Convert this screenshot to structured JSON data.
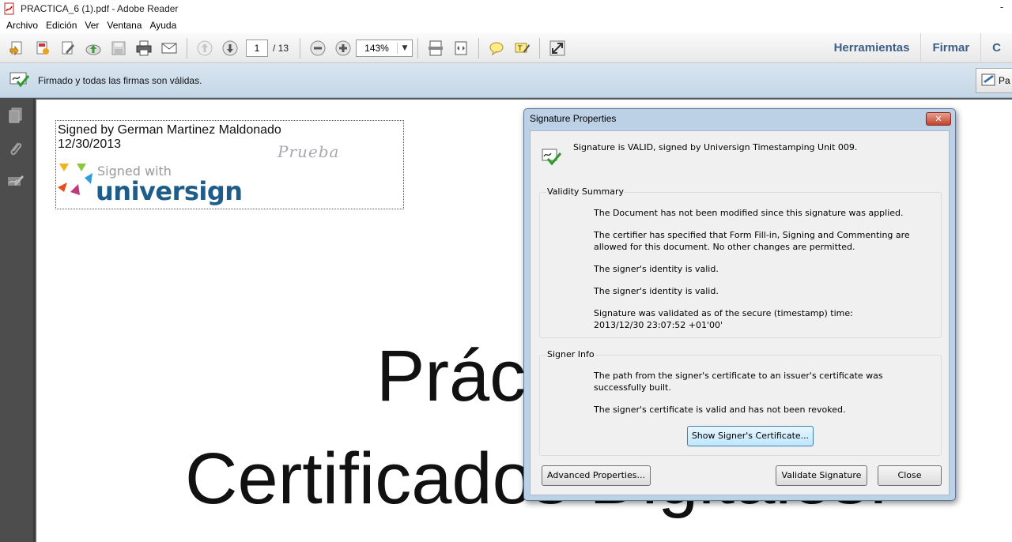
{
  "window": {
    "title": "PRACTICA_6 (1).pdf - Adobe Reader",
    "controls": {
      "minimize": "-",
      "close": "✕"
    }
  },
  "menu": [
    "Archivo",
    "Edición",
    "Ver",
    "Ventana",
    "Ayuda"
  ],
  "toolbar": {
    "page_current": "1",
    "page_total": "/ 13",
    "zoom": "143%",
    "right_links": [
      "Herramientas",
      "Firmar",
      "C"
    ]
  },
  "signature_bar": {
    "message": "Firmado y todas las firmas son válidas.",
    "panel_button_label": "Pa"
  },
  "document": {
    "signature_field": {
      "signed_by": "Signed by German Martinez Maldonado",
      "date": "12/30/2013",
      "handwriting": "Prueba",
      "logo_text": "Signed with",
      "logo_brand": "universign"
    },
    "title_line1": "Práctica",
    "title_line2": "Certificados Digitales."
  },
  "dialog": {
    "title": "Signature Properties",
    "status": "Signature is VALID, signed by Universign Timestamping Unit 009.",
    "validity_summary": {
      "label": "Validity Summary",
      "items": [
        "The Document has not been modified since this signature was applied.",
        "The certifier has specified that Form Fill-in, Signing and Commenting are allowed for this document. No other changes are permitted.",
        "The signer's identity is valid.",
        "The signer's identity is valid.",
        "Signature was validated as of the secure (timestamp) time:",
        "2013/12/30 23:07:52 +01'00'"
      ]
    },
    "signer_info": {
      "label": "Signer Info",
      "items": [
        "The path from the signer's certificate to an issuer's certificate was successfully built.",
        "The signer's certificate is valid and has not been revoked."
      ],
      "show_certificate_button": "Show Signer's Certificate..."
    },
    "buttons": {
      "advanced": "Advanced Properties...",
      "validate": "Validate Signature",
      "close": "Close"
    }
  }
}
